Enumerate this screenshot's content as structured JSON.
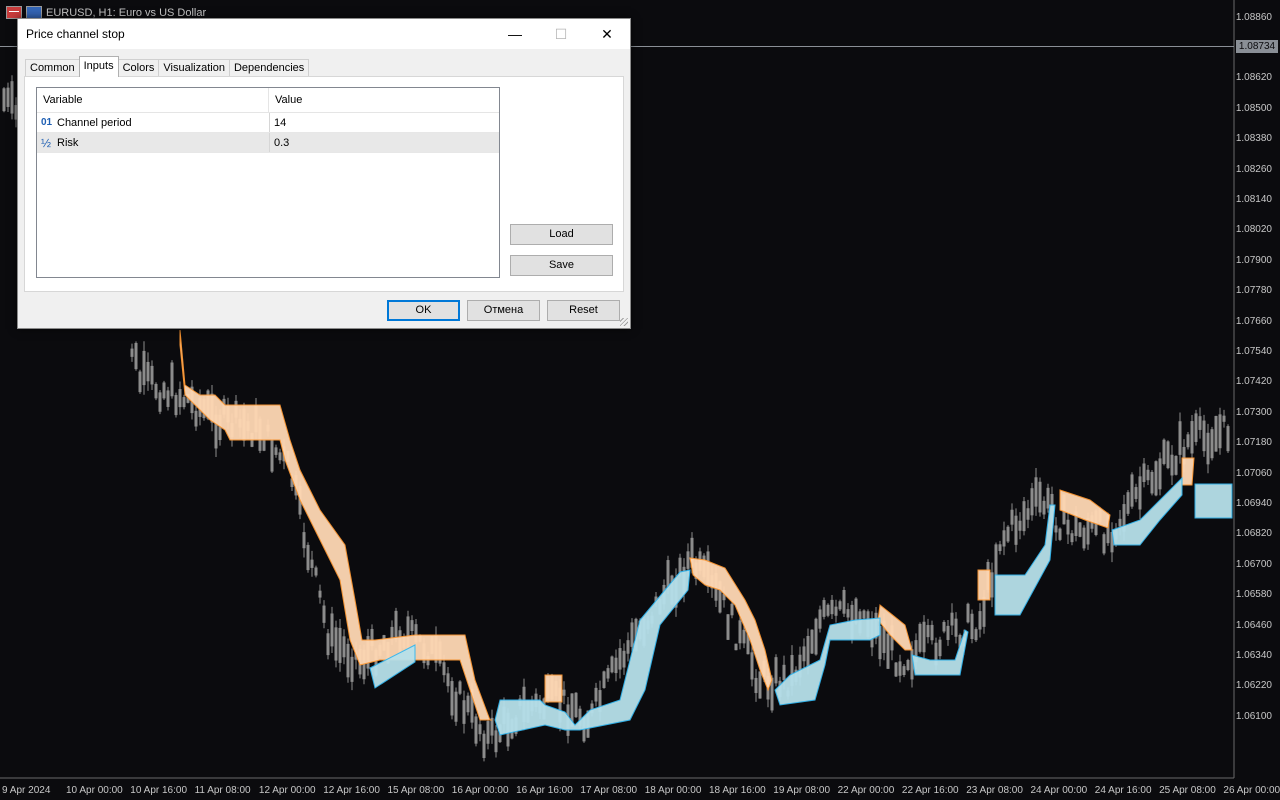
{
  "chart": {
    "header": "EURUSD, H1:  Euro vs US Dollar",
    "current_price": "1.08734",
    "price_axis": [
      "1.08860",
      "1.08620",
      "1.08500",
      "1.08380",
      "1.08260",
      "1.08140",
      "1.08020",
      "1.07900",
      "1.07780",
      "1.07660",
      "1.07540",
      "1.07420",
      "1.07300",
      "1.07180",
      "1.07060",
      "1.06940",
      "1.06820",
      "1.06700",
      "1.06580",
      "1.06460",
      "1.06340",
      "1.06220",
      "1.06100"
    ],
    "time_axis": [
      "9 Apr 2024",
      "10 Apr 00:00",
      "10 Apr 16:00",
      "11 Apr 08:00",
      "12 Apr 00:00",
      "12 Apr 16:00",
      "15 Apr 08:00",
      "16 Apr 00:00",
      "16 Apr 16:00",
      "17 Apr 08:00",
      "18 Apr 00:00",
      "18 Apr 16:00",
      "19 Apr 08:00",
      "22 Apr 00:00",
      "22 Apr 16:00",
      "23 Apr 08:00",
      "24 Apr 00:00",
      "24 Apr 16:00",
      "25 Apr 08:00",
      "26 Apr 00:00"
    ],
    "colors": {
      "background": "#0b0b0e",
      "candles": "#8c8c8c",
      "down_channel": "#ffd8b4",
      "up_channel": "#b6e0ea",
      "down_line": "#ff9933",
      "up_line": "#33b7f0"
    }
  },
  "dialog": {
    "title": "Price channel stop",
    "window_buttons": {
      "minimize": "—",
      "maximize": "☐",
      "close": "✕"
    },
    "tabs": [
      {
        "label": "Common",
        "active": false
      },
      {
        "label": "Inputs",
        "active": true
      },
      {
        "label": "Colors",
        "active": false
      },
      {
        "label": "Visualization",
        "active": false
      },
      {
        "label": "Dependencies",
        "active": false
      }
    ],
    "grid": {
      "headers": [
        "Variable",
        "Value"
      ],
      "rows": [
        {
          "icon": "integer-icon",
          "icon_text": "01",
          "variable": "Channel period",
          "value": "14"
        },
        {
          "icon": "double-icon",
          "icon_text": "½",
          "variable": "Risk",
          "value": "0.3"
        }
      ]
    },
    "side_buttons": {
      "load": "Load",
      "save": "Save"
    },
    "footer_buttons": {
      "ok": "OK",
      "cancel": "Отмена",
      "reset": "Reset"
    }
  }
}
